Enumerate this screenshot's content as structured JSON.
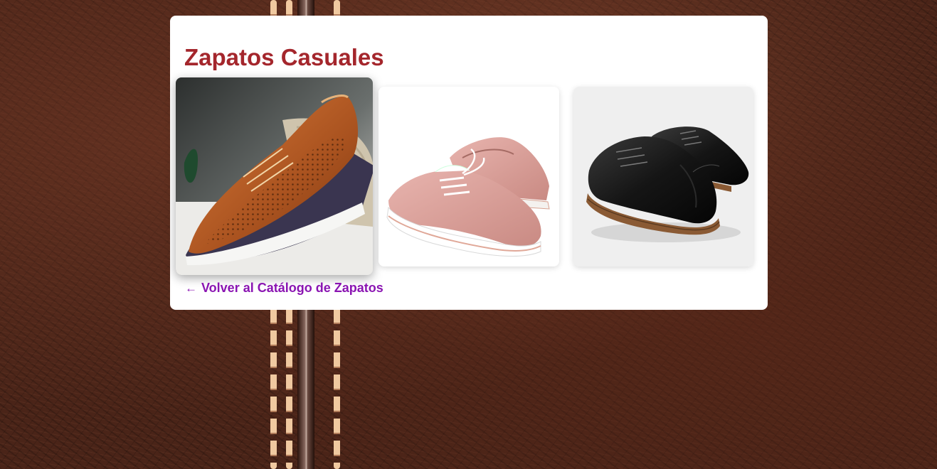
{
  "page": {
    "title": "Zapatos Casuales"
  },
  "gallery": {
    "items": [
      {
        "icon": "brown-perforated-casual-shoe"
      },
      {
        "icon": "pink-platform-oxford-shoe"
      },
      {
        "icon": "black-cap-toe-oxford-shoes"
      }
    ]
  },
  "back_link": {
    "arrow": "←",
    "label": "Volver al Catálogo de Zapatos"
  },
  "colors": {
    "title": "#a4262c",
    "link": "#8a14b2",
    "card": "#ffffff",
    "background": "#4a2418"
  }
}
